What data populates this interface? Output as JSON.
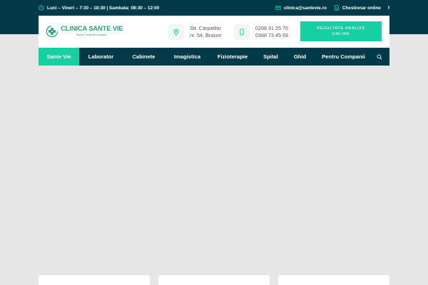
{
  "topbar": {
    "hours": "Luni – Vineri – 7:30 – 18:30 | Sambata: 08:30 – 12:00",
    "email": "clinica@santevie.ro",
    "survey": "Chestionar online",
    "social": "f"
  },
  "header": {
    "logo_title": "CLINICA SANTE VIE",
    "logo_tagline": "Servicii medicale complete",
    "address_line1": "Str. Carpatilor",
    "address_line2": "nr. 54, Brasov",
    "phone1": "0268 31 25 70",
    "phone2": "0368 73 45 69",
    "cta": "REZULTATE ANALIZE ONLINE"
  },
  "nav": {
    "items": [
      {
        "label": "Sante Vie"
      },
      {
        "label": "Laborator"
      },
      {
        "label": "Cabinete"
      },
      {
        "label": "Imagistica"
      },
      {
        "label": "Fizioterapie"
      },
      {
        "label": "Spital"
      },
      {
        "label": "Ghid"
      },
      {
        "label": "Pentru Companii"
      }
    ]
  },
  "colors": {
    "dark": "#033a49",
    "accent": "#17d0a2",
    "logo": "#2aa07a",
    "page_bg": "#e6e6e6"
  },
  "icons": {
    "hours": "clock-icon",
    "email": "envelope-icon",
    "survey": "document-icon",
    "address": "map-pin-icon",
    "phone": "phone-icon",
    "search": "search-icon"
  }
}
